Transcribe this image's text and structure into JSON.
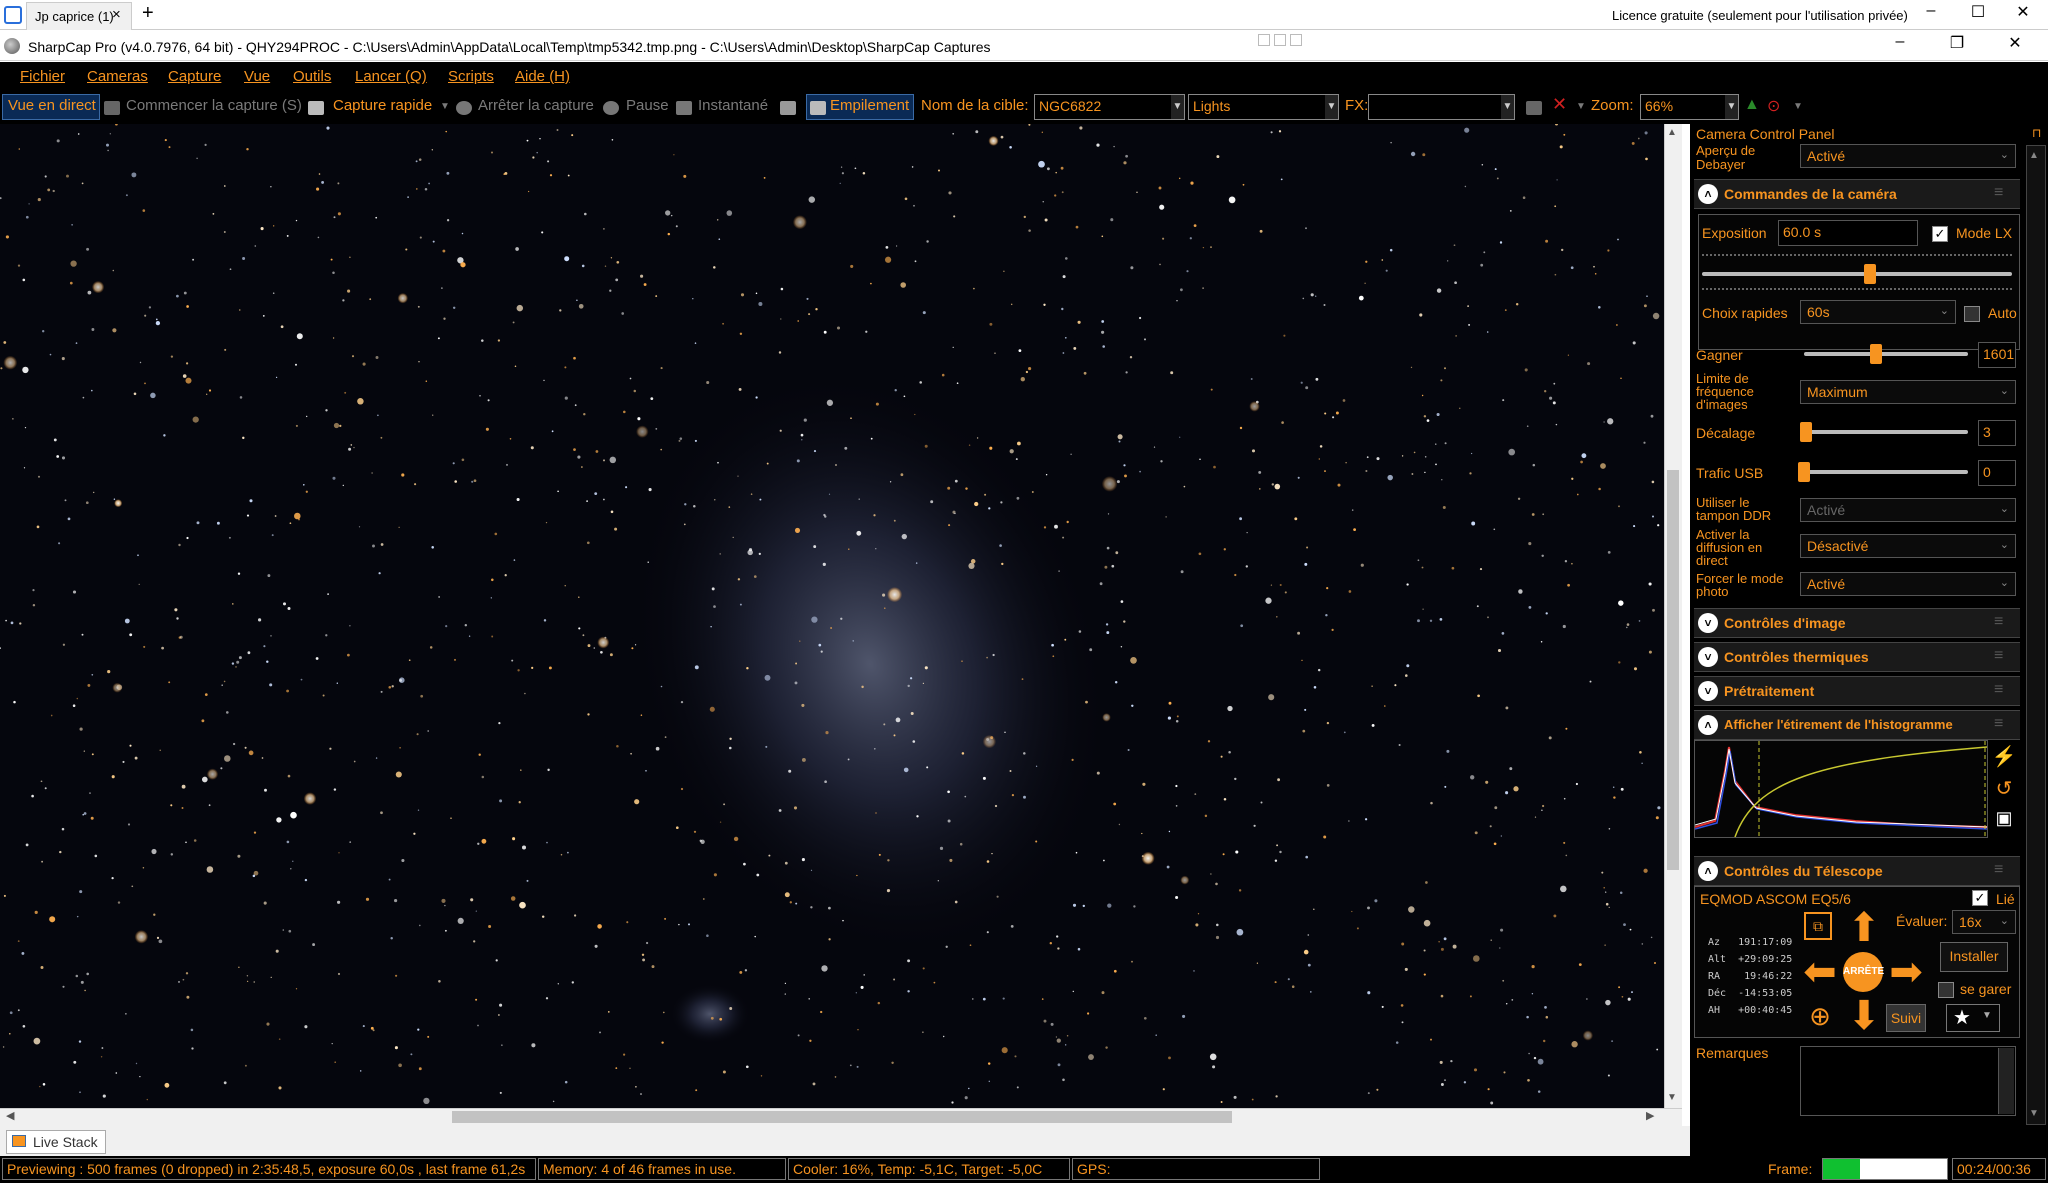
{
  "remote": {
    "tab_title": "Jp caprice (1)",
    "tab_close": "×",
    "add_tab": "+",
    "licence": "Licence gratuite (seulement pour l'utilisation privée)",
    "min": "–",
    "max": "☐",
    "close": "✕"
  },
  "window": {
    "title": "SharpCap Pro (v4.0.7976, 64 bit) - QHY294PROC - C:\\Users\\Admin\\AppData\\Local\\Temp\\tmp5342.tmp.png - C:\\Users\\Admin\\Desktop\\SharpCap Captures",
    "min": "–",
    "max": "❐",
    "close": "✕"
  },
  "menu": [
    "Fichier",
    "Cameras",
    "Capture",
    "Vue",
    "Outils",
    "Lancer (Q)",
    "Scripts",
    "Aide (H)"
  ],
  "toolbar": {
    "live_view": "Vue en direct",
    "start_capture": "Commencer la capture (S)",
    "quick_capture": "Capture rapide",
    "stop_capture": "Arrêter la capture",
    "pause": "Pause",
    "snapshot": "Instantané",
    "stacking": "Empilement",
    "target_label": "Nom de la cible:",
    "target_value": "NGC6822",
    "frame_type": "Lights",
    "fx_label": "FX:",
    "fx_value": "",
    "zoom_label": "Zoom:",
    "zoom_value": "66%"
  },
  "live_stack_tab": "Live Stack",
  "status": {
    "preview": "Previewing : 500 frames (0 dropped) in 2:35:48,5, exposure 60,0s , last frame 61,2s",
    "memory": "Memory: 4 of 46 frames in use.",
    "cooler": "Cooler: 16%, Temp: -5,1C, Target: -5,0C",
    "gps": "GPS:",
    "frame_label": "Frame:",
    "frame_fraction": 0.3,
    "frame_time": "00:24/00:36"
  },
  "panel": {
    "title": "Camera Control Panel",
    "pin": "⊓",
    "debayer_label": "Aperçu de Debayer",
    "debayer_value": "Activé",
    "camera_section": "Commandes de la caméra",
    "exposure_label": "Exposition",
    "exposure_value": "60.0 s",
    "mode_lx_label": "Mode LX",
    "quick_choice_label": "Choix rapides",
    "quick_choice_value": "60s",
    "auto_label": "Auto",
    "gain_label": "Gagner",
    "gain_value": "1601",
    "framerate_label": "Limite de fréquence d'images",
    "framerate_value": "Maximum",
    "offset_label": "Décalage",
    "offset_value": "3",
    "usb_label": "Trafic USB",
    "usb_value": "0",
    "ddr_label": "Utiliser le tampon DDR",
    "ddr_value": "Activé",
    "broadcast_label": "Activer la diffusion en direct",
    "broadcast_value": "Désactivé",
    "photo_label": "Forcer le mode photo",
    "photo_value": "Activé",
    "image_section": "Contrôles d'image",
    "thermal_section": "Contrôles thermiques",
    "preprocess_section": "Prétraitement",
    "histogram_section": "Afficher l'étirement de l'histogramme",
    "telescope_section": "Contrôles du Télescope",
    "mount_name": "EQMOD ASCOM EQ5/6",
    "linked_label": "Lié",
    "rate_label": "Évaluer:",
    "rate_value": "16x",
    "install_label": "Installer",
    "park_label": "se garer",
    "track_label": "Suivi",
    "stop_label": "ARRÊTE",
    "coords": "Az   191:17:09\nAlt  +29:09:25\nRA    19:46:22\nDéc  -14:53:05\nAH   +00:40:45",
    "notes_label": "Remarques"
  },
  "colors": {
    "accent": "#f79420",
    "background": "#000000",
    "frame_progress": "#10c030"
  }
}
